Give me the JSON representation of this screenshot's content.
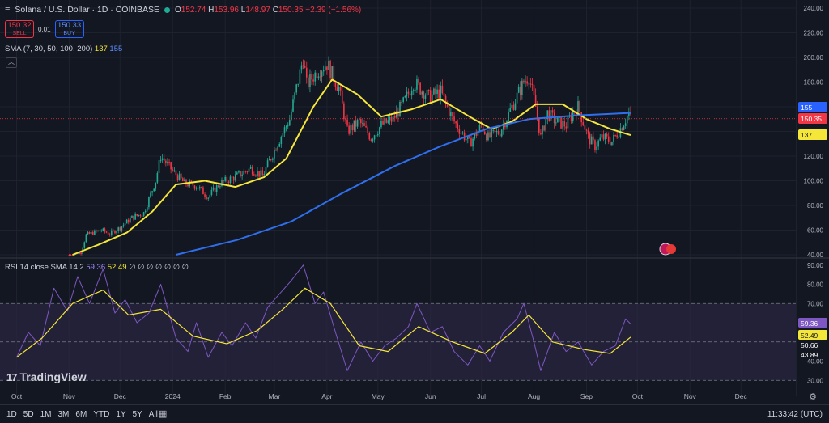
{
  "header": {
    "menu_icon": "hamburger-icon",
    "title": "Solana / U.S. Dollar · 1D · COINBASE",
    "status_color": "#22ab94",
    "ohlc": [
      {
        "label": "O",
        "value": "152.74"
      },
      {
        "label": "H",
        "value": "153.96"
      },
      {
        "label": "L",
        "value": "148.97"
      },
      {
        "label": "C",
        "value": "150.35 −2.39 (−1.56%)"
      }
    ]
  },
  "trade": {
    "sell_price": "150.32",
    "sell_label": "SELL",
    "spread": "0.01",
    "buy_price": "150.33",
    "buy_label": "BUY"
  },
  "sma_legend": {
    "label": "SMA (7, 30, 50, 100, 200)",
    "v1": "137",
    "v2": "155"
  },
  "rsi_legend": {
    "label": "RSI 14 close SMA 14 2",
    "v1": "59.36",
    "v2": "52.49",
    "rest": "∅ ∅ ∅ ∅ ∅ ∅ ∅"
  },
  "collapse_icon": "chevron-up-icon",
  "logo": {
    "mark": "17",
    "text": "TradingView"
  },
  "toolbar": {
    "ranges": [
      "1D",
      "5D",
      "1M",
      "3M",
      "6M",
      "YTD",
      "1Y",
      "5Y",
      "All"
    ],
    "calendar_icon": "calendar-icon",
    "clock": "11:33:42 (UTC)",
    "settings_icon": "gear-icon"
  },
  "colors": {
    "background": "#131722",
    "grid": "#1e222d",
    "up": "#22ab94",
    "down": "#f23645",
    "sma_yellow": "#f5e63a",
    "sma_blue": "#2f6fed",
    "rsi": "#7e57c2",
    "rsi_band": "#2a2540"
  },
  "chart_data": [
    {
      "type": "candlestick",
      "title": "Solana / U.S. Dollar · 1D · COINBASE",
      "x_ticks": [
        "Oct",
        "Nov",
        "Dec",
        "2024",
        "Feb",
        "Mar",
        "Apr",
        "May",
        "Jun",
        "Jul",
        "Aug",
        "Sep",
        "Oct",
        "Nov",
        "Dec"
      ],
      "y_ticks": [
        40,
        60,
        80,
        100,
        120,
        140,
        160,
        180,
        200,
        220,
        240
      ],
      "ylim": [
        40,
        240
      ],
      "last_price_line": 150.35,
      "axis_badges": [
        {
          "value": "155",
          "color": "#2962ff"
        },
        {
          "value": "150.35",
          "color": "#f23645"
        },
        {
          "value": "137",
          "color": "#f5e63a"
        }
      ],
      "series": [
        {
          "name": "Price",
          "points": [
            {
              "date": "2023-11-01",
              "value": 40
            },
            {
              "date": "2023-11-08",
              "value": 42
            },
            {
              "date": "2023-11-11",
              "value": 56
            },
            {
              "date": "2023-11-20",
              "value": 60
            },
            {
              "date": "2023-11-25",
              "value": 57
            },
            {
              "date": "2023-12-01",
              "value": 62
            },
            {
              "date": "2023-12-08",
              "value": 70
            },
            {
              "date": "2023-12-15",
              "value": 74
            },
            {
              "date": "2023-12-22",
              "value": 100
            },
            {
              "date": "2023-12-25",
              "value": 120
            },
            {
              "date": "2024-01-01",
              "value": 108
            },
            {
              "date": "2024-01-08",
              "value": 98
            },
            {
              "date": "2024-01-15",
              "value": 96
            },
            {
              "date": "2024-01-22",
              "value": 87
            },
            {
              "date": "2024-01-29",
              "value": 98
            },
            {
              "date": "2024-02-08",
              "value": 104
            },
            {
              "date": "2024-02-16",
              "value": 110
            },
            {
              "date": "2024-02-23",
              "value": 104
            },
            {
              "date": "2024-03-02",
              "value": 128
            },
            {
              "date": "2024-03-10",
              "value": 150
            },
            {
              "date": "2024-03-18",
              "value": 200
            },
            {
              "date": "2024-03-20",
              "value": 178
            },
            {
              "date": "2024-03-27",
              "value": 190
            },
            {
              "date": "2024-04-01",
              "value": 195
            },
            {
              "date": "2024-04-08",
              "value": 175
            },
            {
              "date": "2024-04-13",
              "value": 140
            },
            {
              "date": "2024-04-20",
              "value": 148
            },
            {
              "date": "2024-04-27",
              "value": 135
            },
            {
              "date": "2024-05-03",
              "value": 145
            },
            {
              "date": "2024-05-10",
              "value": 150
            },
            {
              "date": "2024-05-17",
              "value": 165
            },
            {
              "date": "2024-05-22",
              "value": 180
            },
            {
              "date": "2024-05-31",
              "value": 168
            },
            {
              "date": "2024-06-07",
              "value": 172
            },
            {
              "date": "2024-06-14",
              "value": 150
            },
            {
              "date": "2024-06-24",
              "value": 130
            },
            {
              "date": "2024-07-01",
              "value": 145
            },
            {
              "date": "2024-07-05",
              "value": 135
            },
            {
              "date": "2024-07-12",
              "value": 140
            },
            {
              "date": "2024-07-19",
              "value": 160
            },
            {
              "date": "2024-07-26",
              "value": 180
            },
            {
              "date": "2024-07-29",
              "value": 185
            },
            {
              "date": "2024-08-02",
              "value": 160
            },
            {
              "date": "2024-08-05",
              "value": 135
            },
            {
              "date": "2024-08-09",
              "value": 155
            },
            {
              "date": "2024-08-14",
              "value": 148
            },
            {
              "date": "2024-08-20",
              "value": 145
            },
            {
              "date": "2024-08-24",
              "value": 155
            },
            {
              "date": "2024-08-27",
              "value": 160
            },
            {
              "date": "2024-09-02",
              "value": 135
            },
            {
              "date": "2024-09-06",
              "value": 128
            },
            {
              "date": "2024-09-10",
              "value": 135
            },
            {
              "date": "2024-09-16",
              "value": 132
            },
            {
              "date": "2024-09-20",
              "value": 140
            },
            {
              "date": "2024-09-24",
              "value": 150
            },
            {
              "date": "2024-09-26",
              "value": 155
            },
            {
              "date": "2024-09-27",
              "value": 150.35
            }
          ]
        },
        {
          "name": "SMA 1",
          "value": 137,
          "color": "#f5e63a",
          "points": [
            {
              "date": "2023-11-03",
              "value": 40
            },
            {
              "date": "2023-11-18",
              "value": 48
            },
            {
              "date": "2023-12-05",
              "value": 58
            },
            {
              "date": "2023-12-20",
              "value": 75
            },
            {
              "date": "2024-01-03",
              "value": 97
            },
            {
              "date": "2024-01-20",
              "value": 100
            },
            {
              "date": "2024-02-07",
              "value": 95
            },
            {
              "date": "2024-02-24",
              "value": 103
            },
            {
              "date": "2024-03-08",
              "value": 118
            },
            {
              "date": "2024-03-24",
              "value": 160
            },
            {
              "date": "2024-04-04",
              "value": 182
            },
            {
              "date": "2024-04-19",
              "value": 170
            },
            {
              "date": "2024-05-03",
              "value": 152
            },
            {
              "date": "2024-05-21",
              "value": 158
            },
            {
              "date": "2024-06-07",
              "value": 166
            },
            {
              "date": "2024-06-24",
              "value": 152
            },
            {
              "date": "2024-07-07",
              "value": 142
            },
            {
              "date": "2024-07-19",
              "value": 148
            },
            {
              "date": "2024-08-02",
              "value": 162
            },
            {
              "date": "2024-08-18",
              "value": 162
            },
            {
              "date": "2024-09-01",
              "value": 150
            },
            {
              "date": "2024-09-15",
              "value": 142
            },
            {
              "date": "2024-09-27",
              "value": 137
            }
          ]
        },
        {
          "name": "SMA 2",
          "value": 155,
          "color": "#2f6fed",
          "points": [
            {
              "date": "2024-01-03",
              "value": 40
            },
            {
              "date": "2024-02-08",
              "value": 52
            },
            {
              "date": "2024-03-11",
              "value": 67
            },
            {
              "date": "2024-04-10",
              "value": 90
            },
            {
              "date": "2024-05-11",
              "value": 112
            },
            {
              "date": "2024-06-07",
              "value": 128
            },
            {
              "date": "2024-07-04",
              "value": 142
            },
            {
              "date": "2024-07-29",
              "value": 150
            },
            {
              "date": "2024-08-26",
              "value": 153
            },
            {
              "date": "2024-09-27",
              "value": 155
            }
          ]
        }
      ]
    },
    {
      "type": "line",
      "title": "RSI 14 close SMA 14 2",
      "y_ticks": [
        30,
        40,
        50,
        60,
        70,
        80,
        90
      ],
      "ylim": [
        28,
        92
      ],
      "bands": [
        30,
        50,
        70
      ],
      "axis_badges": [
        {
          "value": "59.36",
          "color": "#7e57c2"
        },
        {
          "value": "52.49",
          "color": "#f5e63a"
        },
        {
          "value": "50.66",
          "color": "#131722"
        },
        {
          "value": "43.89",
          "color": "#131722"
        }
      ],
      "series": [
        {
          "name": "RSI",
          "value": 59.36,
          "color": "#7e57c2",
          "points": [
            {
              "date": "2023-10-01",
              "value": 42
            },
            {
              "date": "2023-10-08",
              "value": 55
            },
            {
              "date": "2023-10-15",
              "value": 48
            },
            {
              "date": "2023-10-23",
              "value": 78
            },
            {
              "date": "2023-10-31",
              "value": 66
            },
            {
              "date": "2023-11-06",
              "value": 84
            },
            {
              "date": "2023-11-13",
              "value": 70
            },
            {
              "date": "2023-11-21",
              "value": 88
            },
            {
              "date": "2023-11-28",
              "value": 65
            },
            {
              "date": "2023-12-04",
              "value": 72
            },
            {
              "date": "2023-12-11",
              "value": 60
            },
            {
              "date": "2023-12-18",
              "value": 65
            },
            {
              "date": "2023-12-25",
              "value": 80
            },
            {
              "date": "2024-01-03",
              "value": 52
            },
            {
              "date": "2024-01-10",
              "value": 45
            },
            {
              "date": "2024-01-15",
              "value": 60
            },
            {
              "date": "2024-01-22",
              "value": 42
            },
            {
              "date": "2024-01-30",
              "value": 55
            },
            {
              "date": "2024-02-05",
              "value": 48
            },
            {
              "date": "2024-02-13",
              "value": 60
            },
            {
              "date": "2024-02-19",
              "value": 52
            },
            {
              "date": "2024-02-26",
              "value": 68
            },
            {
              "date": "2024-03-04",
              "value": 75
            },
            {
              "date": "2024-03-11",
              "value": 82
            },
            {
              "date": "2024-03-18",
              "value": 90
            },
            {
              "date": "2024-03-25",
              "value": 70
            },
            {
              "date": "2024-03-30",
              "value": 76
            },
            {
              "date": "2024-04-06",
              "value": 55
            },
            {
              "date": "2024-04-13",
              "value": 35
            },
            {
              "date": "2024-04-21",
              "value": 50
            },
            {
              "date": "2024-04-28",
              "value": 40
            },
            {
              "date": "2024-05-05",
              "value": 48
            },
            {
              "date": "2024-05-12",
              "value": 52
            },
            {
              "date": "2024-05-19",
              "value": 58
            },
            {
              "date": "2024-05-24",
              "value": 70
            },
            {
              "date": "2024-06-01",
              "value": 55
            },
            {
              "date": "2024-06-08",
              "value": 58
            },
            {
              "date": "2024-06-15",
              "value": 45
            },
            {
              "date": "2024-06-23",
              "value": 38
            },
            {
              "date": "2024-06-30",
              "value": 48
            },
            {
              "date": "2024-07-06",
              "value": 40
            },
            {
              "date": "2024-07-14",
              "value": 55
            },
            {
              "date": "2024-07-22",
              "value": 62
            },
            {
              "date": "2024-07-26",
              "value": 70
            },
            {
              "date": "2024-08-01",
              "value": 50
            },
            {
              "date": "2024-08-05",
              "value": 35
            },
            {
              "date": "2024-08-13",
              "value": 55
            },
            {
              "date": "2024-08-20",
              "value": 45
            },
            {
              "date": "2024-08-27",
              "value": 50
            },
            {
              "date": "2024-09-04",
              "value": 38
            },
            {
              "date": "2024-09-11",
              "value": 45
            },
            {
              "date": "2024-09-18",
              "value": 48
            },
            {
              "date": "2024-09-24",
              "value": 62
            },
            {
              "date": "2024-09-27",
              "value": 59.36
            }
          ]
        },
        {
          "name": "RSI-based MA",
          "value": 52.49,
          "color": "#f5e63a",
          "points": [
            {
              "date": "2023-10-01",
              "value": 42
            },
            {
              "date": "2023-10-16",
              "value": 52
            },
            {
              "date": "2023-11-03",
              "value": 70
            },
            {
              "date": "2023-11-21",
              "value": 77
            },
            {
              "date": "2023-12-06",
              "value": 64
            },
            {
              "date": "2023-12-25",
              "value": 67
            },
            {
              "date": "2024-01-13",
              "value": 53
            },
            {
              "date": "2024-02-02",
              "value": 49
            },
            {
              "date": "2024-02-20",
              "value": 56
            },
            {
              "date": "2024-03-06",
              "value": 67
            },
            {
              "date": "2024-03-19",
              "value": 78
            },
            {
              "date": "2024-04-03",
              "value": 70
            },
            {
              "date": "2024-04-20",
              "value": 48
            },
            {
              "date": "2024-05-07",
              "value": 45
            },
            {
              "date": "2024-05-25",
              "value": 58
            },
            {
              "date": "2024-06-14",
              "value": 50
            },
            {
              "date": "2024-07-03",
              "value": 44
            },
            {
              "date": "2024-07-19",
              "value": 55
            },
            {
              "date": "2024-07-29",
              "value": 64
            },
            {
              "date": "2024-08-12",
              "value": 50
            },
            {
              "date": "2024-08-31",
              "value": 46
            },
            {
              "date": "2024-09-15",
              "value": 44
            },
            {
              "date": "2024-09-27",
              "value": 52.49
            }
          ]
        }
      ]
    }
  ]
}
